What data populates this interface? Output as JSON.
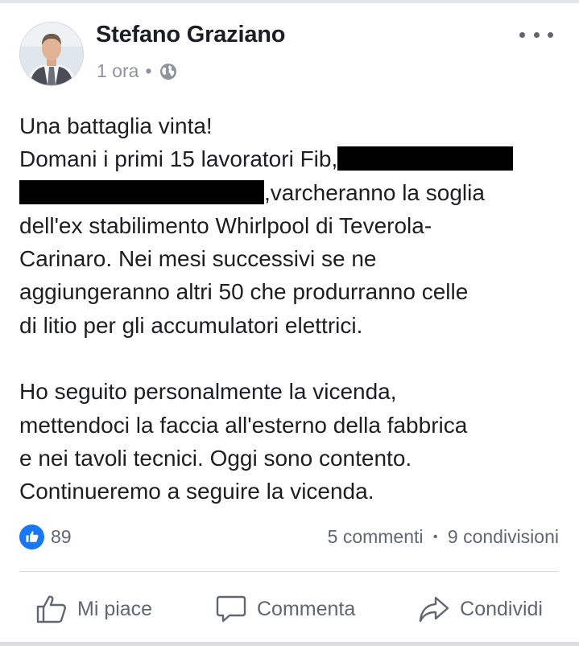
{
  "post": {
    "author": "Stefano Graziano",
    "time": "1 ora",
    "separator": "•",
    "privacy_icon": "globe-icon",
    "more_icon": "more-options-icon",
    "body": {
      "line1": "Una battaglia vinta!",
      "line2_start": "Domani i primi 15 lavoratori Fib,",
      "line3_end": ",varcheranno la soglia",
      "line4": "dell'ex stabilimento Whirlpool di Teverola-",
      "line5": "Carinaro. Nei mesi successivi se ne",
      "line6": "aggiungeranno altri 50 che produrranno celle",
      "line7": "di litio per gli accumulatori elettrici.",
      "line8": "Ho seguito personalmente la vicenda,",
      "line9": "mettendoci la faccia all'esterno della fabbrica",
      "line10": "e nei tavoli tecnici. Oggi sono contento.",
      "line11": "Continueremo a seguire la vicenda."
    }
  },
  "stats": {
    "like_count": "89",
    "comments": "5 commenti",
    "separator": "•",
    "shares": "9 condivisioni"
  },
  "actions": {
    "like_label": "Mi piace",
    "comment_label": "Commenta",
    "share_label": "Condividi"
  },
  "colors": {
    "like_blue": "#1877f2",
    "text_primary": "#1c1e21",
    "text_secondary": "#606770"
  }
}
